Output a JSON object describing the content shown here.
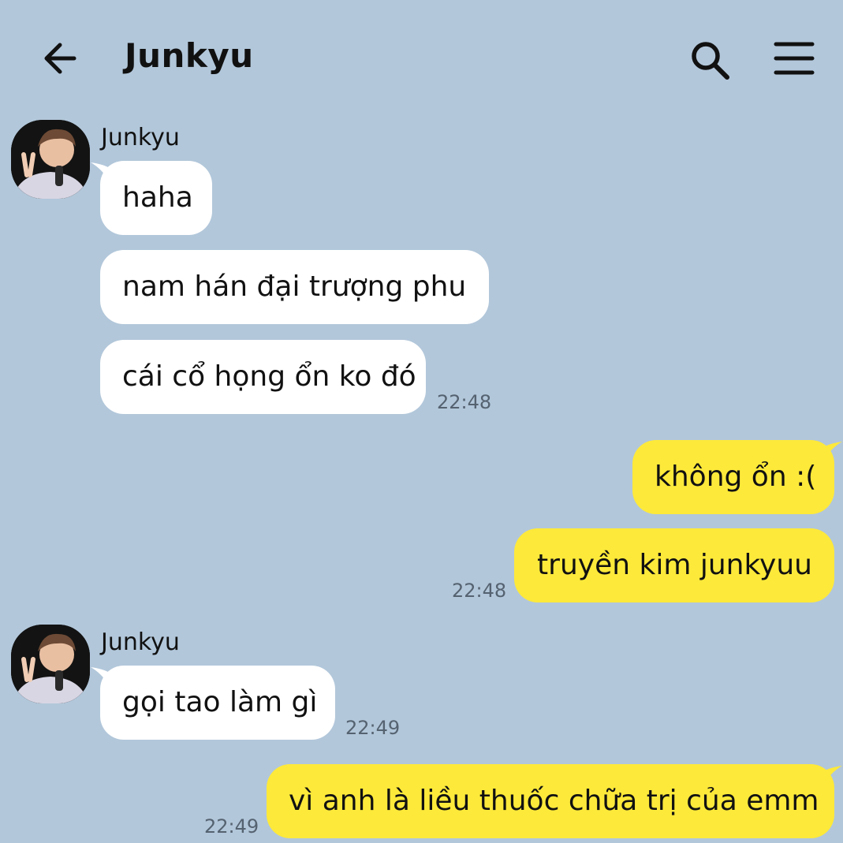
{
  "header": {
    "title": "Junkyu",
    "back_icon": "arrow-left-icon",
    "search_icon": "search-icon",
    "menu_icon": "hamburger-menu-icon"
  },
  "colors": {
    "background": "#b2c7da",
    "incoming_bubble": "#ffffff",
    "outgoing_bubble": "#fde93a",
    "timestamp": "#556270"
  },
  "messages": {
    "group1": {
      "sender": "Junkyu",
      "m1": "haha",
      "m2": "nam hán đại trượng phu",
      "m3": "cái cổ họng ổn ko đó",
      "time": "22:48"
    },
    "out1": {
      "m1": "không ổn :(",
      "m2": "truyền kim junkyuu",
      "time": "22:48"
    },
    "group2": {
      "sender": "Junkyu",
      "m1": "gọi tao làm gì",
      "time": "22:49"
    },
    "out2": {
      "m1": "vì anh là liều thuốc chữa trị của emm",
      "time": "22:49"
    }
  }
}
